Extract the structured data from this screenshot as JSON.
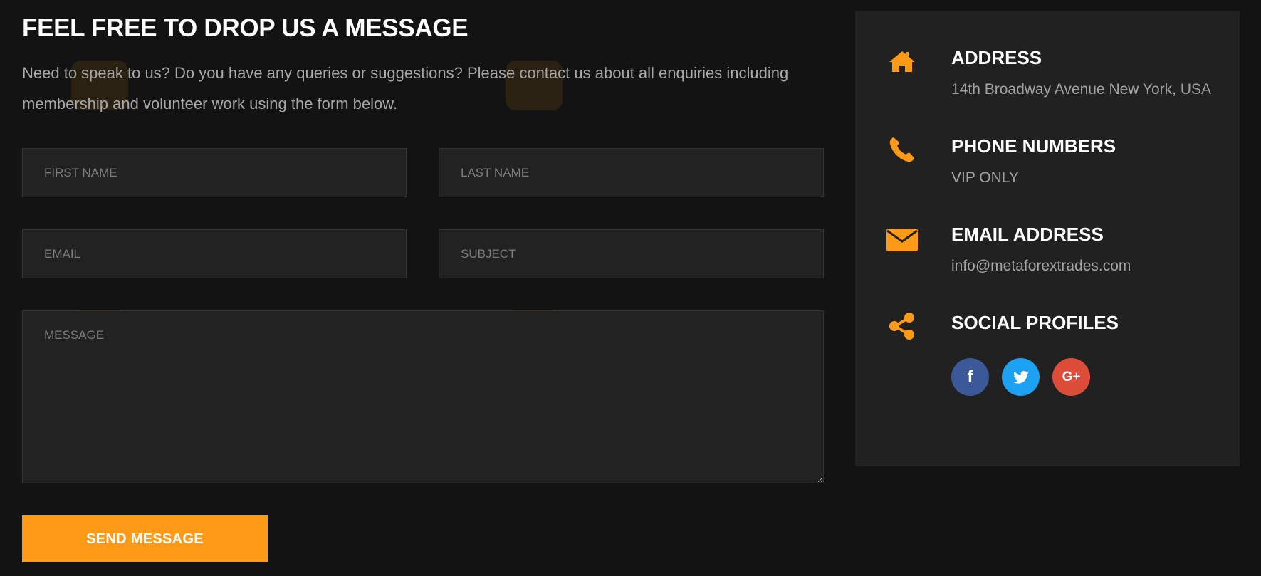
{
  "form": {
    "heading": "FEEL FREE TO DROP US A MESSAGE",
    "intro": "Need to speak to us? Do you have any queries or suggestions? Please contact us about all enquiries including membership and volunteer work using the form below.",
    "fields": {
      "first_name": {
        "placeholder": "FIRST NAME",
        "value": ""
      },
      "last_name": {
        "placeholder": "LAST NAME",
        "value": ""
      },
      "email": {
        "placeholder": "EMAIL",
        "value": ""
      },
      "subject": {
        "placeholder": "SUBJECT",
        "value": ""
      },
      "message": {
        "placeholder": "MESSAGE",
        "value": ""
      }
    },
    "submit_label": "SEND MESSAGE"
  },
  "contact_info": {
    "items": [
      {
        "icon": "home-icon",
        "title": "ADDRESS",
        "text": "14th Broadway Avenue New York, USA"
      },
      {
        "icon": "phone-icon",
        "title": "PHONE NUMBERS",
        "text": "VIP ONLY"
      },
      {
        "icon": "envelope-icon",
        "title": "EMAIL ADDRESS",
        "text": "info@metaforextrades.com"
      },
      {
        "icon": "share-icon",
        "title": "SOCIAL PROFILES",
        "text": ""
      }
    ],
    "social_profiles": [
      {
        "name": "facebook",
        "icon": "facebook-icon",
        "glyph": "f",
        "color": "#3b5998"
      },
      {
        "name": "twitter",
        "icon": "twitter-icon",
        "glyph": "",
        "color": "#1da1f2"
      },
      {
        "name": "google-plus",
        "icon": "google-plus-icon",
        "glyph": "G+",
        "color": "#dd4b39"
      }
    ]
  },
  "theme": {
    "background": "#131313",
    "panel": "#212121",
    "field": "#222222",
    "accent": "#ff9a16"
  }
}
